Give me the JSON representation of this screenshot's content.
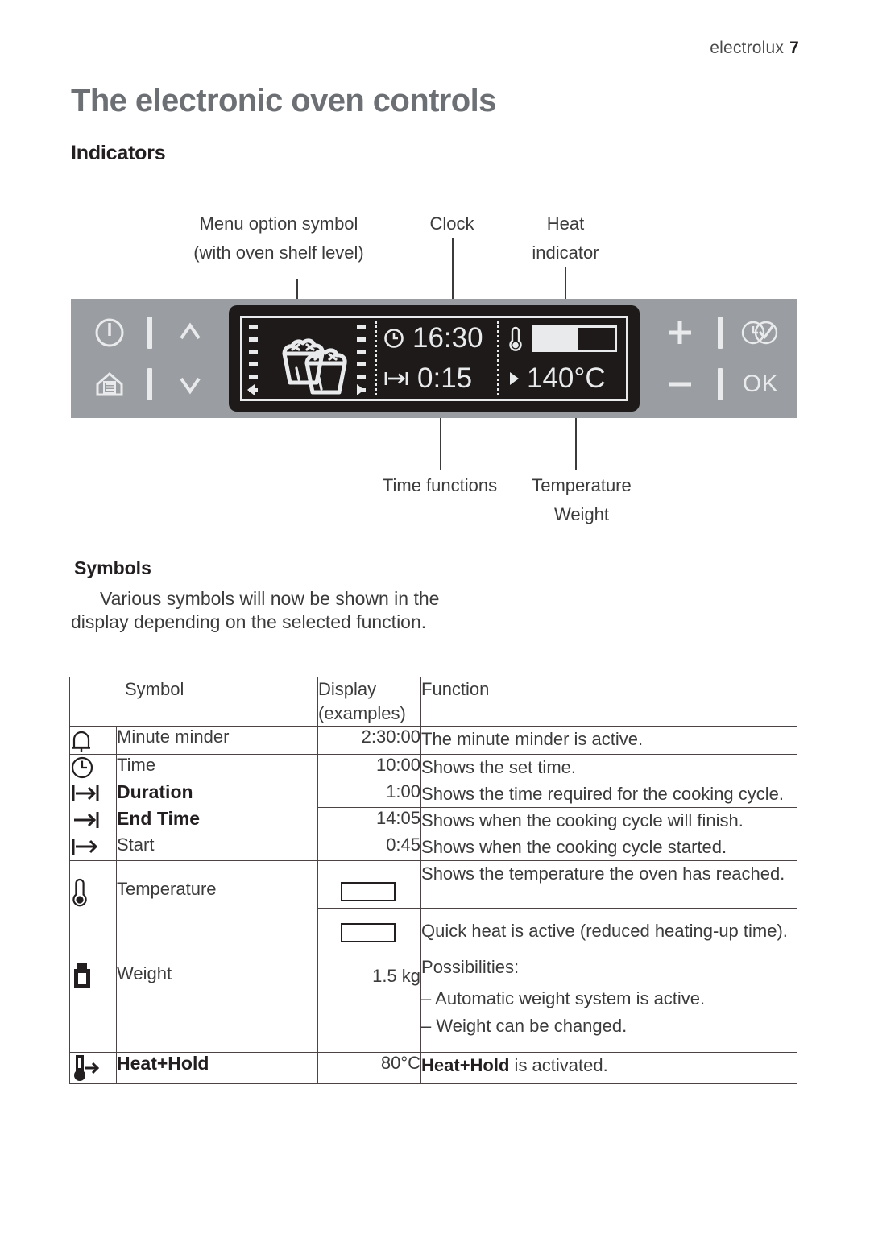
{
  "header": {
    "brand": "electrolux",
    "page_number": "7"
  },
  "title": "The electronic oven controls",
  "subtitle": "Indicators",
  "diagram": {
    "callouts": {
      "menu_option_line1": "Menu option symbol",
      "menu_option_line2": "(with oven shelf level)",
      "clock": "Clock",
      "heat_line1": "Heat",
      "heat_line2": "indicator",
      "time_functions": "Time functions",
      "temperature": "Temperature",
      "weight": "Weight"
    },
    "keys": {
      "power": "power-icon",
      "menu": "house-menu-icon",
      "up": "chevron-up-icon",
      "down": "chevron-down-icon",
      "plus": "+",
      "minus": "–",
      "clock_check": "clock-check-icon",
      "ok": "OK"
    },
    "lcd": {
      "menu_symbol": "two-muffins-icon",
      "clock_icon": "clock-icon",
      "clock_value": "16:30",
      "duration_icon": "duration-icon",
      "duration_value": "0:15",
      "temp_icon": "thermometer-icon",
      "heat_bar_fill_percent": 55,
      "temp_value": "140°C"
    }
  },
  "symbols_section": {
    "heading": "Symbols",
    "paragraph": "Various symbols will now be shown in the display depending on the selected function."
  },
  "table": {
    "headers": {
      "symbol": "Symbol",
      "display_line1": "Display",
      "display_line2": "(examples)",
      "function": "Function"
    },
    "rows": [
      {
        "icon": "bell-icon",
        "name": "Minute minder",
        "bold_name": false,
        "display": "2:30:00",
        "display_type": "text",
        "function": "The minute minder is active."
      },
      {
        "icon": "clock-icon",
        "name": "Time",
        "bold_name": false,
        "display": "10:00",
        "display_type": "text",
        "function": "Shows the set time."
      },
      {
        "icon": "duration-icon",
        "name": "Duration",
        "bold_name": true,
        "display": "1:00",
        "display_type": "text",
        "function": "Shows the time required for the cooking cycle."
      },
      {
        "icon": "end-time-icon",
        "name": "End Time",
        "bold_name": true,
        "display": "14:05",
        "display_type": "text",
        "function": "Shows when the cooking cycle will finish."
      },
      {
        "icon": "start-icon",
        "name": "Start",
        "bold_name": false,
        "display": "0:45",
        "display_type": "text",
        "function": "Shows when the cooking cycle started."
      },
      {
        "icon": "thermometer-icon",
        "name": "Temperature",
        "bold_name": false,
        "display": "bar-half",
        "display_type": "bar",
        "function": "Shows the temperature the oven has reached."
      },
      {
        "icon": "",
        "name": "",
        "bold_name": false,
        "display": "bar-tick",
        "display_type": "bar",
        "function": "Quick heat is active (reduced heating-up time)."
      },
      {
        "icon": "weight-icon",
        "name": "Weight",
        "bold_name": false,
        "display": "1.5 kg",
        "display_type": "text",
        "function": "Possibilities:",
        "function_lines": [
          "– Automatic weight system is active.",
          "– Weight can be changed."
        ]
      },
      {
        "icon": "heat-hold-icon",
        "name": "Heat+Hold",
        "bold_name": true,
        "display": "80°C",
        "display_type": "text",
        "function_bold_prefix": "Heat+Hold",
        "function_suffix": " is activated."
      }
    ]
  }
}
